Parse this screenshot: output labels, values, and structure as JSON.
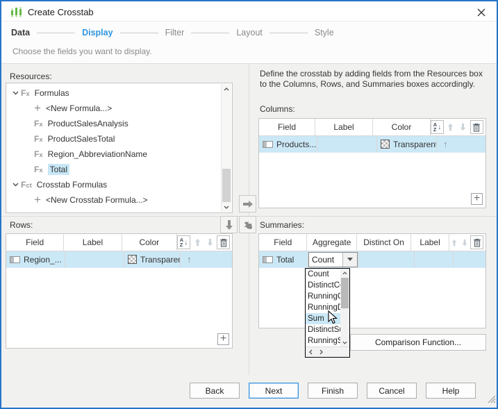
{
  "window": {
    "title": "Create Crosstab"
  },
  "steps": {
    "items": [
      {
        "label": "Data"
      },
      {
        "label": "Display"
      },
      {
        "label": "Filter"
      },
      {
        "label": "Layout"
      },
      {
        "label": "Style"
      }
    ],
    "subtitle": "Choose the fields you want to display."
  },
  "resources": {
    "label": "Resources:",
    "tree": [
      {
        "label": "Formulas"
      },
      {
        "label": "<New Formula...>"
      },
      {
        "label": "ProductSalesAnalysis"
      },
      {
        "label": "ProductSalesTotal"
      },
      {
        "label": "Region_AbbreviationName"
      },
      {
        "label": "Total"
      },
      {
        "label": "Crosstab Formulas"
      },
      {
        "label": "<New Crosstab Formula...>"
      }
    ]
  },
  "intro": "Define the crosstab by adding fields from the Resources box to the Columns, Rows, and Summaries boxes accordingly.",
  "columns_section": {
    "label": "Columns:",
    "headers": {
      "field": "Field",
      "label": "Label",
      "color": "Color"
    },
    "row": {
      "field": "Products...",
      "label": "",
      "color": "Transparent",
      "move": "↑"
    },
    "add": "+"
  },
  "rows_section": {
    "label": "Rows:",
    "headers": {
      "field": "Field",
      "label": "Label",
      "color": "Color"
    },
    "row": {
      "field": "Region_...",
      "label": "",
      "color": "Transparent",
      "move": "↑"
    },
    "add": "+"
  },
  "summaries_section": {
    "label": "Summaries:",
    "headers": {
      "field": "Field",
      "aggregate": "Aggregate",
      "distinct_on": "Distinct On",
      "label": "Label"
    },
    "row": {
      "field": "Total",
      "aggregate": "Count"
    }
  },
  "dropdown": {
    "items": [
      "Count",
      "DistinctCount",
      "RunningCount",
      "RunningDistinctCount",
      "Sum",
      "DistinctSum",
      "RunningSum"
    ],
    "selected": "Sum"
  },
  "comparison_button": "Comparison Function...",
  "footer": {
    "back": "Back",
    "next": "Next",
    "finish": "Finish",
    "cancel": "Cancel",
    "help": "Help"
  },
  "colors": {
    "window_border": "#2674c9",
    "active_step": "#2e96e2",
    "selection": "#cbe8f6",
    "icon_green": "#63b946"
  }
}
